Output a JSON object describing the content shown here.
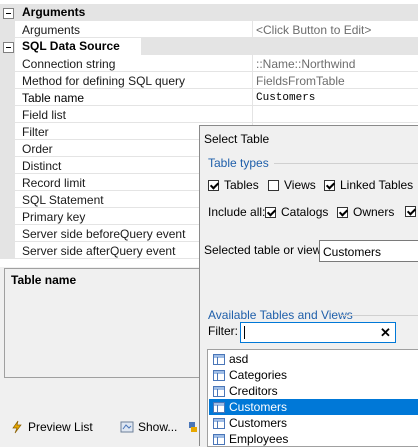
{
  "grid": {
    "categories": [
      {
        "label": "Arguments"
      },
      {
        "label": "SQL Data Source"
      }
    ],
    "arguments_rows": [
      {
        "name": "Arguments",
        "value": "<Click Button to Edit>"
      }
    ],
    "sql_rows": [
      {
        "name": "Connection string",
        "value": "::Name::Northwind"
      },
      {
        "name": "Method for defining SQL query",
        "value": "FieldsFromTable"
      },
      {
        "name": "Table name",
        "value": "Customers"
      },
      {
        "name": "Field list",
        "value": ""
      },
      {
        "name": "Filter",
        "value": ""
      },
      {
        "name": "Order",
        "value": ""
      },
      {
        "name": "Distinct",
        "value": ""
      },
      {
        "name": "Record limit",
        "value": ""
      },
      {
        "name": "SQL Statement",
        "value": ""
      },
      {
        "name": "Primary key",
        "value": ""
      },
      {
        "name": "Server side beforeQuery event",
        "value": ""
      },
      {
        "name": "Server side afterQuery event",
        "value": ""
      }
    ]
  },
  "description": {
    "title": "Table name"
  },
  "toolbar": {
    "preview_label": "Preview List",
    "show_label": "Show..."
  },
  "dialog": {
    "title": "Select Table",
    "table_types_label": "Table types",
    "types": [
      {
        "label": "Tables",
        "checked": true
      },
      {
        "label": "Views",
        "checked": false
      },
      {
        "label": "Linked Tables",
        "checked": true
      }
    ],
    "include_all_label": "Include all:",
    "include": [
      {
        "label": "Catalogs",
        "checked": true
      },
      {
        "label": "Owners",
        "checked": true
      }
    ],
    "selected_label": "Selected table or view:",
    "selected_value": "Customers",
    "available_label": "Available Tables and Views",
    "filter_label": "Filter:",
    "filter_value": "",
    "items": [
      {
        "label": "asd",
        "selected": false
      },
      {
        "label": "Categories",
        "selected": false
      },
      {
        "label": "Creditors",
        "selected": false
      },
      {
        "label": "Customers",
        "selected": true
      },
      {
        "label": "Customers",
        "selected": false
      },
      {
        "label": "Employees",
        "selected": false
      }
    ]
  }
}
